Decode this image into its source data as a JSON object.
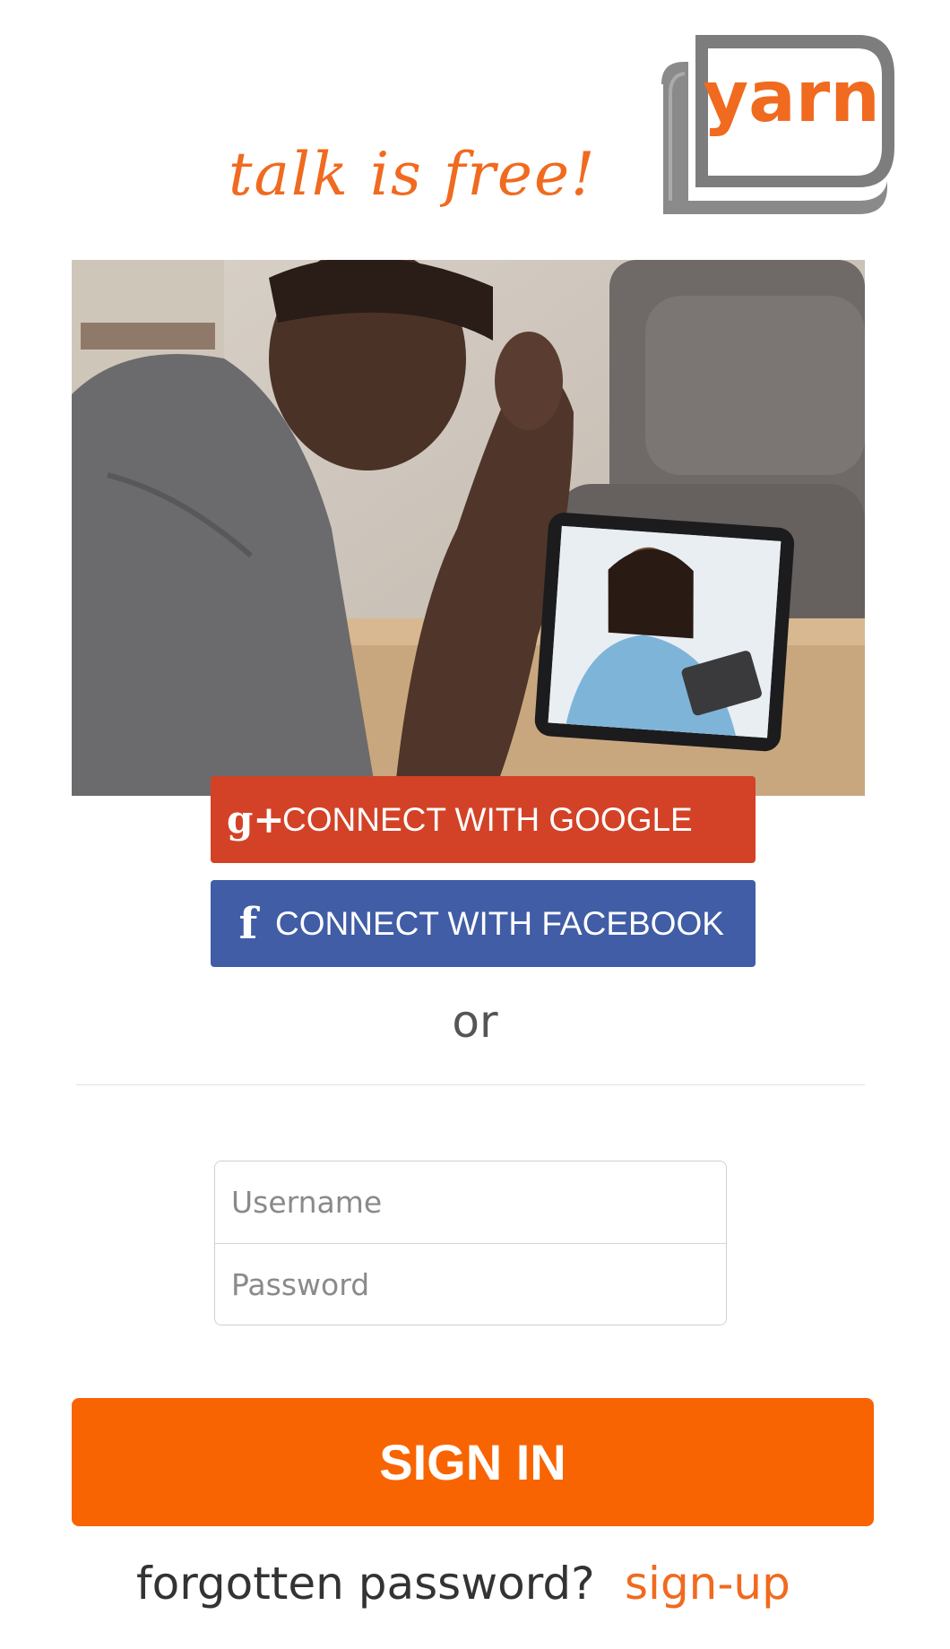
{
  "header": {
    "tagline": "talk is free!",
    "logo_text": "yarn"
  },
  "hero": {
    "description": "photo"
  },
  "social": {
    "google_icon": "g+",
    "google_label": "CONNECT WITH GOOGLE",
    "facebook_icon": "f",
    "facebook_label": "CONNECT WITH FACEBOOK"
  },
  "divider_text": "or",
  "login": {
    "username_placeholder": "Username",
    "username_value": "",
    "password_placeholder": "Password",
    "password_value": "",
    "signin_label": "SIGN IN"
  },
  "footer": {
    "forgot_label": "forgotten password?",
    "signup_label": "sign-up"
  },
  "colors": {
    "brand_orange": "#f96402",
    "google_red": "#d34227",
    "facebook_blue": "#405da5",
    "logo_gray": "#7d7d7d"
  },
  "icons": [
    "google-plus-icon",
    "facebook-icon"
  ]
}
